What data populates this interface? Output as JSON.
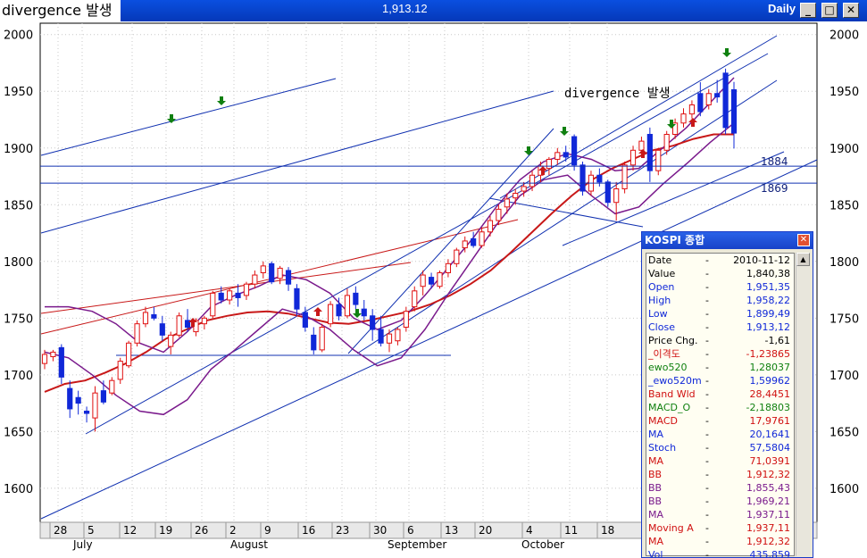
{
  "window": {
    "title_left": "divergence 발생",
    "title_value": "1,913.12",
    "period": "Daily",
    "min_symbol": "_",
    "max_symbol": "□",
    "close_symbol": "✕"
  },
  "chart": {
    "annotation": "divergence 발생",
    "y_ticks": [
      "2000",
      "1950",
      "1900",
      "1850",
      "1800",
      "1750",
      "1700",
      "1650",
      "1600"
    ],
    "y_tick_values": [
      2000,
      1950,
      1900,
      1850,
      1800,
      1750,
      1700,
      1650,
      1600
    ],
    "h_levels": [
      {
        "label": "1884",
        "value": 1884
      },
      {
        "label": "1869",
        "value": 1869
      }
    ],
    "x_days": [
      "28",
      "5",
      "12",
      "19",
      "26",
      "2",
      "9",
      "16",
      "23",
      "30",
      "6",
      "13",
      "20",
      "4",
      "11",
      "18"
    ],
    "x_months": [
      "July",
      "August",
      "September",
      "October"
    ],
    "colors": {
      "up": "#e01010",
      "down": "#1028d8",
      "ma_red": "#c81818",
      "bb_purple": "#7a1a8c",
      "trend_blue": "#1030b0"
    }
  },
  "chart_data": {
    "type": "candlestick",
    "title": "",
    "ylim": [
      1570,
      2010
    ],
    "x_labels": [
      "28",
      "5",
      "12",
      "19",
      "26",
      "2",
      "9",
      "16",
      "23",
      "30",
      "6",
      "13",
      "20",
      "4",
      "11",
      "18"
    ],
    "month_labels": [
      "July",
      "August",
      "September",
      "October"
    ],
    "candles": [
      {
        "o": 1710,
        "h": 1722,
        "l": 1705,
        "c": 1718
      },
      {
        "o": 1716,
        "h": 1722,
        "l": 1712,
        "c": 1720
      },
      {
        "o": 1724,
        "h": 1727,
        "l": 1692,
        "c": 1698
      },
      {
        "o": 1688,
        "h": 1695,
        "l": 1662,
        "c": 1670
      },
      {
        "o": 1680,
        "h": 1686,
        "l": 1665,
        "c": 1675
      },
      {
        "o": 1668,
        "h": 1672,
        "l": 1658,
        "c": 1666
      },
      {
        "o": 1662,
        "h": 1690,
        "l": 1650,
        "c": 1684
      },
      {
        "o": 1686,
        "h": 1695,
        "l": 1674,
        "c": 1676
      },
      {
        "o": 1684,
        "h": 1698,
        "l": 1682,
        "c": 1695
      },
      {
        "o": 1696,
        "h": 1715,
        "l": 1692,
        "c": 1712
      },
      {
        "o": 1708,
        "h": 1730,
        "l": 1706,
        "c": 1728
      },
      {
        "o": 1728,
        "h": 1748,
        "l": 1725,
        "c": 1745
      },
      {
        "o": 1745,
        "h": 1760,
        "l": 1742,
        "c": 1755
      },
      {
        "o": 1753,
        "h": 1760,
        "l": 1748,
        "c": 1750
      },
      {
        "o": 1745,
        "h": 1752,
        "l": 1730,
        "c": 1735
      },
      {
        "o": 1725,
        "h": 1738,
        "l": 1718,
        "c": 1735
      },
      {
        "o": 1735,
        "h": 1755,
        "l": 1733,
        "c": 1752
      },
      {
        "o": 1748,
        "h": 1758,
        "l": 1738,
        "c": 1742
      },
      {
        "o": 1738,
        "h": 1750,
        "l": 1734,
        "c": 1748
      },
      {
        "o": 1745,
        "h": 1752,
        "l": 1740,
        "c": 1750
      },
      {
        "o": 1752,
        "h": 1774,
        "l": 1750,
        "c": 1772
      },
      {
        "o": 1772,
        "h": 1778,
        "l": 1763,
        "c": 1766
      },
      {
        "o": 1766,
        "h": 1776,
        "l": 1762,
        "c": 1774
      },
      {
        "o": 1772,
        "h": 1780,
        "l": 1760,
        "c": 1768
      },
      {
        "o": 1770,
        "h": 1782,
        "l": 1766,
        "c": 1780
      },
      {
        "o": 1780,
        "h": 1792,
        "l": 1776,
        "c": 1788
      },
      {
        "o": 1790,
        "h": 1800,
        "l": 1785,
        "c": 1796
      },
      {
        "o": 1798,
        "h": 1800,
        "l": 1780,
        "c": 1782
      },
      {
        "o": 1785,
        "h": 1796,
        "l": 1780,
        "c": 1794
      },
      {
        "o": 1792,
        "h": 1795,
        "l": 1774,
        "c": 1780
      },
      {
        "o": 1776,
        "h": 1780,
        "l": 1752,
        "c": 1758
      },
      {
        "o": 1755,
        "h": 1760,
        "l": 1738,
        "c": 1742
      },
      {
        "o": 1735,
        "h": 1742,
        "l": 1718,
        "c": 1722
      },
      {
        "o": 1722,
        "h": 1745,
        "l": 1720,
        "c": 1742
      },
      {
        "o": 1745,
        "h": 1765,
        "l": 1742,
        "c": 1762
      },
      {
        "o": 1762,
        "h": 1768,
        "l": 1748,
        "c": 1752
      },
      {
        "o": 1752,
        "h": 1776,
        "l": 1750,
        "c": 1770
      },
      {
        "o": 1772,
        "h": 1778,
        "l": 1758,
        "c": 1762
      },
      {
        "o": 1758,
        "h": 1766,
        "l": 1748,
        "c": 1752
      },
      {
        "o": 1752,
        "h": 1758,
        "l": 1730,
        "c": 1740
      },
      {
        "o": 1740,
        "h": 1752,
        "l": 1725,
        "c": 1728
      },
      {
        "o": 1728,
        "h": 1740,
        "l": 1720,
        "c": 1736
      },
      {
        "o": 1730,
        "h": 1742,
        "l": 1726,
        "c": 1740
      },
      {
        "o": 1742,
        "h": 1760,
        "l": 1738,
        "c": 1756
      },
      {
        "o": 1760,
        "h": 1778,
        "l": 1756,
        "c": 1774
      },
      {
        "o": 1778,
        "h": 1792,
        "l": 1770,
        "c": 1788
      },
      {
        "o": 1786,
        "h": 1790,
        "l": 1776,
        "c": 1780
      },
      {
        "o": 1778,
        "h": 1792,
        "l": 1776,
        "c": 1790
      },
      {
        "o": 1790,
        "h": 1802,
        "l": 1786,
        "c": 1798
      },
      {
        "o": 1798,
        "h": 1812,
        "l": 1795,
        "c": 1810
      },
      {
        "o": 1812,
        "h": 1822,
        "l": 1808,
        "c": 1818
      },
      {
        "o": 1820,
        "h": 1826,
        "l": 1812,
        "c": 1814
      },
      {
        "o": 1814,
        "h": 1830,
        "l": 1812,
        "c": 1826
      },
      {
        "o": 1826,
        "h": 1840,
        "l": 1822,
        "c": 1836
      },
      {
        "o": 1836,
        "h": 1850,
        "l": 1832,
        "c": 1846
      },
      {
        "o": 1848,
        "h": 1860,
        "l": 1842,
        "c": 1855
      },
      {
        "o": 1856,
        "h": 1864,
        "l": 1850,
        "c": 1860
      },
      {
        "o": 1862,
        "h": 1870,
        "l": 1857,
        "c": 1866
      },
      {
        "o": 1866,
        "h": 1880,
        "l": 1862,
        "c": 1876
      },
      {
        "o": 1876,
        "h": 1888,
        "l": 1870,
        "c": 1884
      },
      {
        "o": 1882,
        "h": 1892,
        "l": 1876,
        "c": 1890
      },
      {
        "o": 1890,
        "h": 1900,
        "l": 1885,
        "c": 1896
      },
      {
        "o": 1896,
        "h": 1902,
        "l": 1888,
        "c": 1892
      },
      {
        "o": 1910,
        "h": 1912,
        "l": 1880,
        "c": 1885
      },
      {
        "o": 1885,
        "h": 1888,
        "l": 1858,
        "c": 1862
      },
      {
        "o": 1862,
        "h": 1880,
        "l": 1858,
        "c": 1876
      },
      {
        "o": 1876,
        "h": 1882,
        "l": 1866,
        "c": 1870
      },
      {
        "o": 1870,
        "h": 1872,
        "l": 1848,
        "c": 1852
      },
      {
        "o": 1852,
        "h": 1870,
        "l": 1836,
        "c": 1864
      },
      {
        "o": 1864,
        "h": 1888,
        "l": 1860,
        "c": 1885
      },
      {
        "o": 1885,
        "h": 1902,
        "l": 1880,
        "c": 1898
      },
      {
        "o": 1898,
        "h": 1910,
        "l": 1892,
        "c": 1906
      },
      {
        "o": 1912,
        "h": 1918,
        "l": 1870,
        "c": 1880
      },
      {
        "o": 1880,
        "h": 1900,
        "l": 1876,
        "c": 1898
      },
      {
        "o": 1898,
        "h": 1915,
        "l": 1894,
        "c": 1912
      },
      {
        "o": 1912,
        "h": 1926,
        "l": 1908,
        "c": 1922
      },
      {
        "o": 1922,
        "h": 1935,
        "l": 1918,
        "c": 1930
      },
      {
        "o": 1930,
        "h": 1942,
        "l": 1926,
        "c": 1938
      },
      {
        "o": 1948,
        "h": 1958,
        "l": 1928,
        "c": 1932
      },
      {
        "o": 1938,
        "h": 1952,
        "l": 1934,
        "c": 1948
      },
      {
        "o": 1948,
        "h": 1960,
        "l": 1940,
        "c": 1945
      },
      {
        "o": 1966,
        "h": 1970,
        "l": 1912,
        "c": 1918
      },
      {
        "o": 1951.35,
        "h": 1958.22,
        "l": 1899.49,
        "c": 1913.12
      }
    ],
    "series": [
      {
        "values": [
          1685,
          1692,
          1695,
          1702,
          1710,
          1720,
          1732,
          1740,
          1748,
          1752,
          1755,
          1756,
          1754,
          1750,
          1746,
          1745,
          1748,
          1752,
          1756,
          1762,
          1770,
          1780,
          1792,
          1808,
          1825,
          1842,
          1858,
          1872,
          1882,
          1890,
          1898,
          1902,
          1908,
          1912,
          1912
        ]
      },
      {
        "values": [
          1760,
          1760,
          1756,
          1745,
          1728,
          1720,
          1738,
          1760,
          1770,
          1778,
          1788,
          1784,
          1772,
          1750,
          1740,
          1748,
          1770,
          1795,
          1820,
          1848,
          1872,
          1888,
          1895,
          1890,
          1880,
          1882,
          1900,
          1918,
          1940,
          1962
        ]
      },
      {
        "values": [
          1720,
          1715,
          1700,
          1682,
          1668,
          1665,
          1678,
          1705,
          1722,
          1740,
          1758,
          1752,
          1740,
          1722,
          1708,
          1715,
          1740,
          1772,
          1802,
          1832,
          1858,
          1872,
          1876,
          1858,
          1842,
          1848,
          1868,
          1886,
          1905,
          1922
        ]
      }
    ]
  },
  "data_window": {
    "title": "KOSPI 종합",
    "rows": [
      {
        "label": "Date",
        "value": "2010-11-12",
        "color": "#000000"
      },
      {
        "label": "Value",
        "value": "1,840,38",
        "color": "#000000"
      },
      {
        "label": "Open",
        "value": "1,951,35",
        "color": "#1028d8"
      },
      {
        "label": "High",
        "value": "1,958,22",
        "color": "#1028d8"
      },
      {
        "label": "Low",
        "value": "1,899,49",
        "color": "#1028d8"
      },
      {
        "label": "Close",
        "value": "1,913,12",
        "color": "#1028d8"
      },
      {
        "label": "Price Chg.",
        "value": "-1,61",
        "color": "#000000"
      },
      {
        "label": "_이격도",
        "value": "-1,23865",
        "color": "#d01010"
      },
      {
        "label": "ewo520",
        "value": "1,28037",
        "color": "#108010"
      },
      {
        "label": "_ewo520m",
        "value": "1,59962",
        "color": "#1028d8"
      },
      {
        "label": "Band Wld",
        "value": "28,4451",
        "color": "#d01010"
      },
      {
        "label": "MACD_O",
        "value": "-2,18803",
        "color": "#108010"
      },
      {
        "label": "MACD",
        "value": "17,9761",
        "color": "#d01010"
      },
      {
        "label": "MA",
        "value": "20,1641",
        "color": "#1028d8"
      },
      {
        "label": "Stoch",
        "value": "57,5804",
        "color": "#1028d8"
      },
      {
        "label": "MA",
        "value": "71,0391",
        "color": "#d01010"
      },
      {
        "label": "BB",
        "value": "1,912,32",
        "color": "#d01010"
      },
      {
        "label": "BB",
        "value": "1,855,43",
        "color": "#7a1a8c"
      },
      {
        "label": "BB",
        "value": "1,969,21",
        "color": "#7a1a8c"
      },
      {
        "label": "MA",
        "value": "1,937,11",
        "color": "#7a1a8c"
      },
      {
        "label": "Moving A",
        "value": "1,937,11",
        "color": "#d01010"
      },
      {
        "label": "MA",
        "value": "1,912,32",
        "color": "#d01010"
      },
      {
        "label": "Vol",
        "value": "435,859",
        "color": "#1028d8"
      }
    ]
  }
}
